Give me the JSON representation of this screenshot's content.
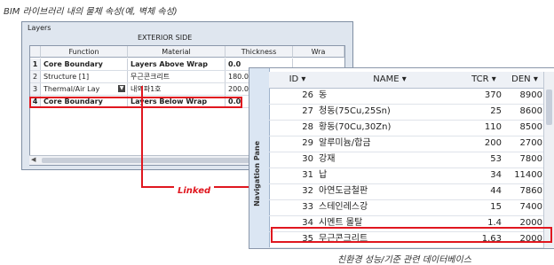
{
  "captions": {
    "top": "BIM 라이브러리 내의 물체 속성(예, 벽체 속성)",
    "bottom": "친환경 성능/기준 관련 데이터베이스"
  },
  "layers_dialog": {
    "title": "Layers",
    "subtitle": "EXTERIOR SIDE",
    "columns": [
      "",
      "Function",
      "Material",
      "Thickness",
      "Wra"
    ],
    "rows": [
      {
        "num": "1",
        "function": "Core Boundary",
        "material": "Layers Above Wrap",
        "thickness": "0.0",
        "bold": true
      },
      {
        "num": "2",
        "function": "Structure [1]",
        "material": "무근콘크리트",
        "thickness": "180.0",
        "bold": false
      },
      {
        "num": "3",
        "function": "Thermal/Air Lay",
        "material": "내외파1호",
        "thickness": "200.0",
        "bold": false
      },
      {
        "num": "4",
        "function": "Core Boundary",
        "material": "Layers Below Wrap",
        "thickness": "0.0",
        "bold": true
      }
    ]
  },
  "db_table": {
    "nav_pane_label": "Navigation Pane",
    "columns": {
      "id": "ID",
      "name": "NAME",
      "tcr": "TCR",
      "den": "DEN"
    },
    "rows": [
      {
        "id": "26",
        "name": "동",
        "tcr": "370",
        "den": "8900"
      },
      {
        "id": "27",
        "name": "청동(75Cu,25Sn)",
        "tcr": "25",
        "den": "8600"
      },
      {
        "id": "28",
        "name": "황동(70Cu,30Zn)",
        "tcr": "110",
        "den": "8500"
      },
      {
        "id": "29",
        "name": "알루미늄/합금",
        "tcr": "200",
        "den": "2700"
      },
      {
        "id": "30",
        "name": "강재",
        "tcr": "53",
        "den": "7800"
      },
      {
        "id": "31",
        "name": "납",
        "tcr": "34",
        "den": "11400"
      },
      {
        "id": "32",
        "name": "아연도금철판",
        "tcr": "44",
        "den": "7860"
      },
      {
        "id": "33",
        "name": "스테인레스강",
        "tcr": "15",
        "den": "7400"
      },
      {
        "id": "34",
        "name": "시멘트 몰탈",
        "tcr": "1.4",
        "den": "2000"
      },
      {
        "id": "35",
        "name": "무근콘크리트",
        "tcr": "1.63",
        "den": "2000"
      }
    ]
  },
  "link": {
    "label": "Linked"
  },
  "colors": {
    "highlight": "#e0171f",
    "window_bg": "#dfe6ef",
    "nav_pane": "#dbe6f3"
  }
}
